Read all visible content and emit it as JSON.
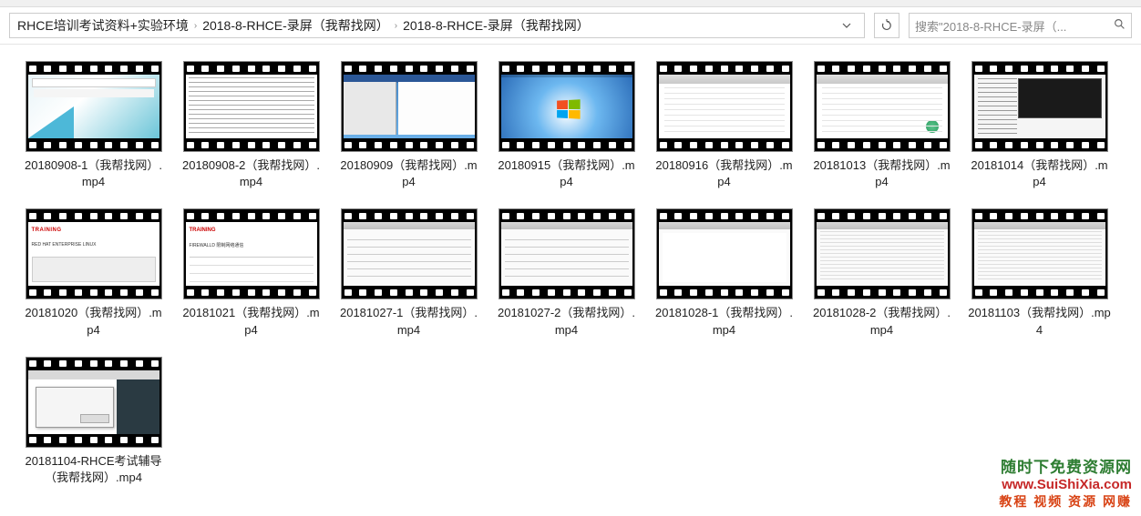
{
  "breadcrumbs": {
    "items": [
      "RHCE培训考试资料+实验环境",
      "2018-8-RHCE-录屏（我帮找网）",
      "2018-8-RHCE-录屏（我帮找网）"
    ],
    "separator": "›"
  },
  "search": {
    "placeholder": "搜索\"2018-8-RHCE-录屏（..."
  },
  "files": [
    {
      "name": "20180908-1（我帮找网）.mp4"
    },
    {
      "name": "20180908-2（我帮找网）.mp4"
    },
    {
      "name": "20180909（我帮找网）.mp4"
    },
    {
      "name": "20180915（我帮找网）.mp4"
    },
    {
      "name": "20180916（我帮找网）.mp4"
    },
    {
      "name": "20181013（我帮找网）.mp4"
    },
    {
      "name": "20181014（我帮找网）.mp4"
    },
    {
      "name": "20181020（我帮找网）.mp4"
    },
    {
      "name": "20181021（我帮找网）.mp4"
    },
    {
      "name": "20181027-1（我帮找网）.mp4"
    },
    {
      "name": "20181027-2（我帮找网）.mp4"
    },
    {
      "name": "20181028-1（我帮找网）.mp4"
    },
    {
      "name": "20181028-2（我帮找网）.mp4"
    },
    {
      "name": "20181103（我帮找网）.mp4"
    },
    {
      "name": "20181104-RHCE考试辅导（我帮找网）.mp4"
    }
  ],
  "watermark": {
    "line1": "随时下免费资源网",
    "line2": "www.SuiShiXia.com",
    "line3": "教程 视频 资源 网赚"
  }
}
